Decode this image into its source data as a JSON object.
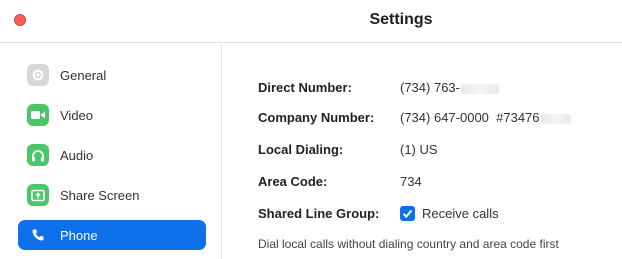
{
  "window": {
    "title": "Settings"
  },
  "sidebar": {
    "items": [
      {
        "label": "General",
        "icon": "gear-icon",
        "color": "#d0d0d0"
      },
      {
        "label": "Video",
        "icon": "video-camera-icon",
        "color": "#4bc56a"
      },
      {
        "label": "Audio",
        "icon": "headphones-icon",
        "color": "#4bc56a"
      },
      {
        "label": "Share Screen",
        "icon": "share-screen-icon",
        "color": "#4bc56a"
      },
      {
        "label": "Phone",
        "icon": "phone-icon",
        "color": "#0e71eb",
        "active": true
      }
    ]
  },
  "phone": {
    "direct_number_label": "Direct Number:",
    "direct_number_value": "(734) 763-",
    "company_number_label": "Company Number:",
    "company_number_value": "(734) 647-0000  #73476",
    "local_dialing_label": "Local Dialing:",
    "local_dialing_value": "(1) US",
    "area_code_label": "Area Code:",
    "area_code_value": "734",
    "shared_line_label": "Shared Line Group:",
    "receive_calls_label": "Receive calls",
    "receive_calls_checked": true,
    "local_dialing_note": "Dial local calls without dialing country and area code first"
  },
  "colors": {
    "accent": "#0e71eb",
    "close": "#fd5f57"
  }
}
